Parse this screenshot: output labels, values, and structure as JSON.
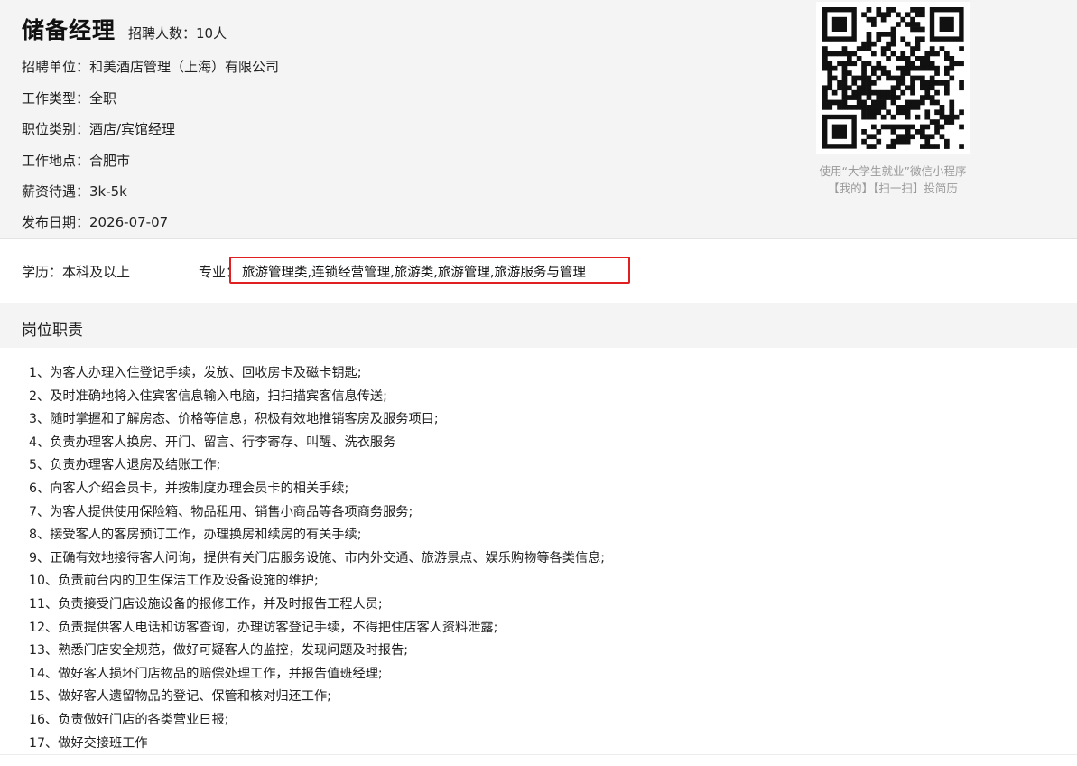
{
  "job": {
    "title": "储备经理",
    "headcount": "招聘人数：10人",
    "employer": "招聘单位：和美酒店管理（上海）有限公司",
    "work_type": "工作类型：全职",
    "category": "职位类别：酒店/宾馆经理",
    "location": "工作地点：合肥市",
    "salary": "薪资待遇：3k-5k",
    "publish_date": "发布日期：2026-07-07"
  },
  "qr": {
    "icon": "qr-code-icon",
    "caption_line1": "使用“大学生就业”微信小程序",
    "caption_line2": "【我的】【扫一扫】投简历"
  },
  "requirements": {
    "education": "学历：本科及以上",
    "major_label": "专业：",
    "major_value": "旅游管理类,连锁经营管理,旅游类,旅游管理,旅游服务与管理",
    "highlight_color": "#e02020"
  },
  "duties_section": {
    "title": "岗位职责",
    "items": [
      "1、为客人办理入住登记手续，发放、回收房卡及磁卡钥匙;",
      "2、及时准确地将入住宾客信息输入电脑，扫扫描宾客信息传送;",
      "3、随时掌握和了解房态、价格等信息，积极有效地推销客房及服务项目;",
      "4、负责办理客人换房、开门、留言、行李寄存、叫醒、洗衣服务",
      "5、负责办理客人退房及结账工作;",
      "6、向客人介绍会员卡，并按制度办理会员卡的相关手续;",
      "7、为客人提供使用保险箱、物品租用、销售小商品等各项商务服务;",
      "8、接受客人的客房预订工作，办理换房和续房的有关手续;",
      "9、正确有效地接待客人问询，提供有关门店服务设施、市内外交通、旅游景点、娱乐购物等各类信息;",
      "10、负责前台内的卫生保洁工作及设备设施的维护;",
      "11、负责接受门店设施设备的报修工作，并及时报告工程人员;",
      "12、负责提供客人电话和访客查询，办理访客登记手续，不得把住店客人资料泄露;",
      "13、熟悉门店安全规范，做好可疑客人的监控，发现问题及时报告;",
      "14、做好客人损坏门店物品的赔偿处理工作，并报告值班经理;",
      "15、做好客人遗留物品的登记、保管和核对归还工作;",
      "16、负责做好门店的各类营业日报;",
      "17、做好交接班工作"
    ]
  }
}
